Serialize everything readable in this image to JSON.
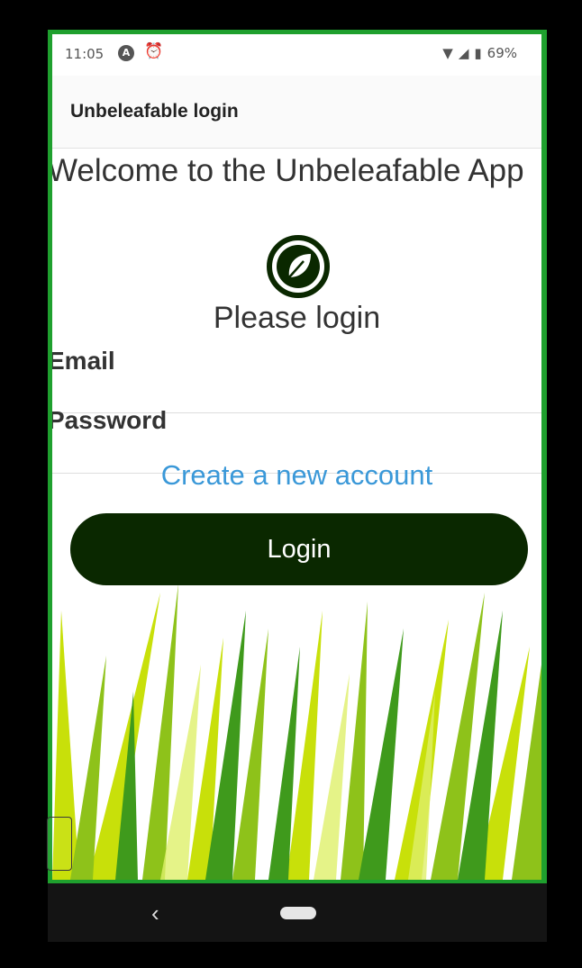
{
  "status": {
    "time": "11:05",
    "battery": "69%",
    "icons": [
      "a-badge-icon",
      "alarm-icon",
      "wifi-icon",
      "signal-icon",
      "battery-icon"
    ]
  },
  "appbar": {
    "title": "Unbeleafable login"
  },
  "main": {
    "welcome": "Welcome to the Unbeleafable App",
    "logo_icon": "leaf-icon",
    "please_login": "Please login",
    "email_label": "Email",
    "email_value": "",
    "password_label": "Password",
    "password_value": "",
    "create_account": "Create a new account",
    "login_button": "Login"
  },
  "colors": {
    "frame_green": "#1fa02e",
    "button_dark_green": "#0a2800",
    "link_blue": "#3a98d8"
  },
  "navbar": {
    "back_icon": "back-chevron-icon",
    "home_icon": "home-pill-icon"
  }
}
